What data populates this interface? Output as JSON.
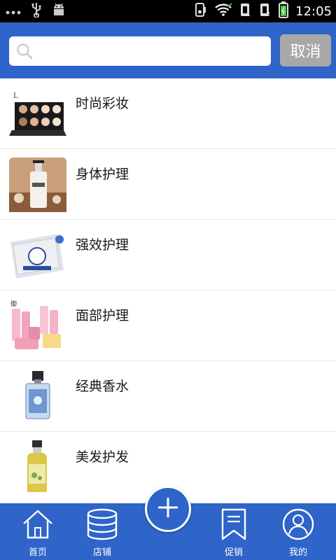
{
  "status_bar": {
    "time": "12:05"
  },
  "search": {
    "placeholder": "",
    "value": "",
    "cancel_label": "取消"
  },
  "categories": [
    {
      "label": "时尚彩妆",
      "thumb_icon": "makeup-palette-icon"
    },
    {
      "label": "身体护理",
      "thumb_icon": "body-lotion-icon"
    },
    {
      "label": "强效护理",
      "thumb_icon": "face-mask-pack-icon"
    },
    {
      "label": "面部护理",
      "thumb_icon": "skincare-set-icon"
    },
    {
      "label": "经典香水",
      "thumb_icon": "perfume-bottle-icon"
    },
    {
      "label": "美发护发",
      "thumb_icon": "shampoo-bottle-icon"
    }
  ],
  "bottom_nav": {
    "items": [
      {
        "label": "首页",
        "icon": "home-icon"
      },
      {
        "label": "店铺",
        "icon": "database-icon"
      },
      {
        "label": "促销",
        "icon": "bookmark-icon"
      },
      {
        "label": "我的",
        "icon": "user-icon"
      }
    ],
    "fab_icon": "plus-icon"
  },
  "colors": {
    "primary": "#2f64c8",
    "cancel_button": "#a8a8a8"
  }
}
